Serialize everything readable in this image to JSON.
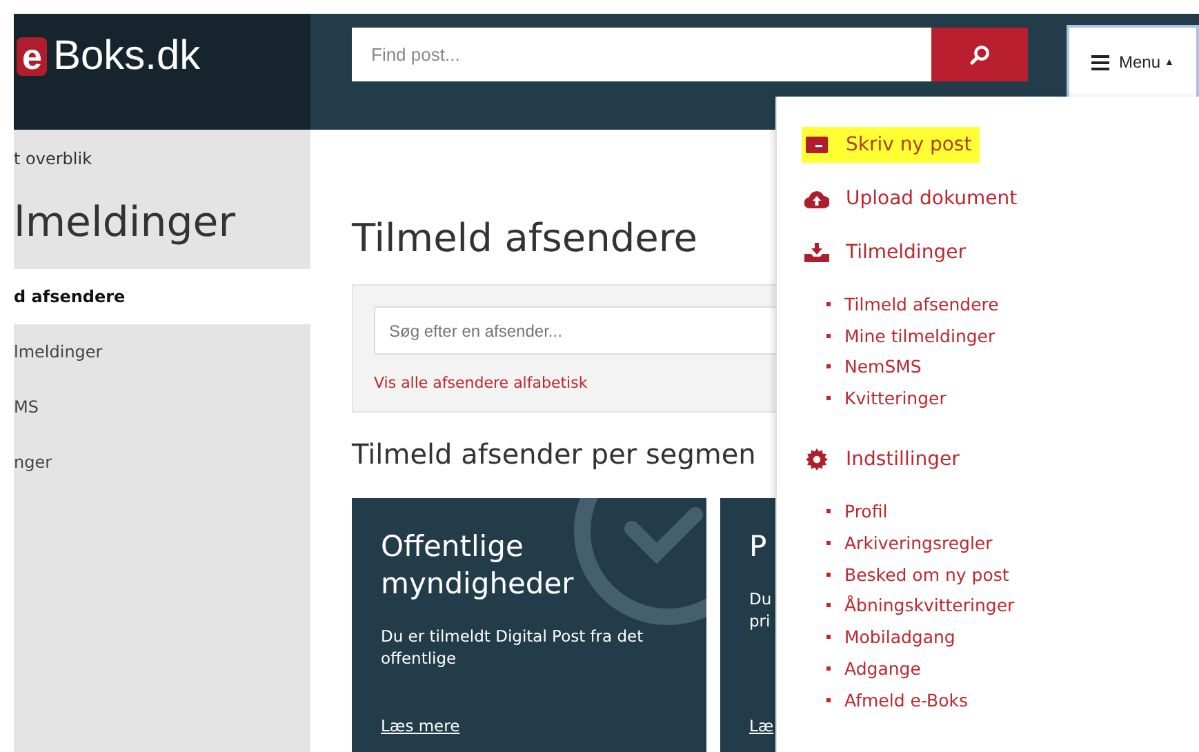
{
  "header": {
    "logo_badge": "e",
    "logo_text": "Boks.dk",
    "search": {
      "placeholder": "Find post..."
    },
    "menu_button": {
      "label": "Menu",
      "caret": "▲",
      "expanded": true
    }
  },
  "sidebar": {
    "back_link": "t overblik",
    "title": "lmeldinger",
    "items": [
      {
        "label": "d afsendere",
        "selected": true
      },
      {
        "label": "lmeldinger",
        "selected": false
      },
      {
        "label": "MS",
        "selected": false
      },
      {
        "label": "nger",
        "selected": false
      }
    ]
  },
  "main": {
    "title": "Tilmeld afsendere",
    "sender_search": {
      "placeholder": "Søg efter en afsender...",
      "link": "Vis alle afsendere alfabetisk"
    },
    "segments_title": "Tilmeld afsender per segmen",
    "cards": [
      {
        "title_lines": [
          "Offentlige",
          "myndigheder"
        ],
        "description_lines": [
          "Du er tilmeldt Digital Post fra det",
          "offentlige"
        ],
        "link": "Læs mere",
        "checked": true
      },
      {
        "title_lines": [
          "P"
        ],
        "description_lines": [
          "Du",
          "pri"
        ],
        "link": "Læ"
      }
    ]
  },
  "menu": {
    "sections": [
      {
        "kind": "compose",
        "label": "Skriv ny post",
        "highlighted": true
      },
      {
        "kind": "upload",
        "label": "Upload dokument",
        "highlighted": false
      },
      {
        "kind": "signup",
        "label": "Tilmeldinger",
        "highlighted": false,
        "children": [
          "Tilmeld afsendere",
          "Mine tilmeldinger",
          "NemSMS",
          "Kvitteringer"
        ]
      },
      {
        "kind": "settings",
        "label": "Indstillinger",
        "highlighted": false,
        "children": [
          "Profil",
          "Arkiveringsregler",
          "Besked om ny post",
          "Åbningskvitteringer",
          "Mobiladgang",
          "Adgange",
          "Afmeld e-Boks"
        ]
      }
    ]
  }
}
